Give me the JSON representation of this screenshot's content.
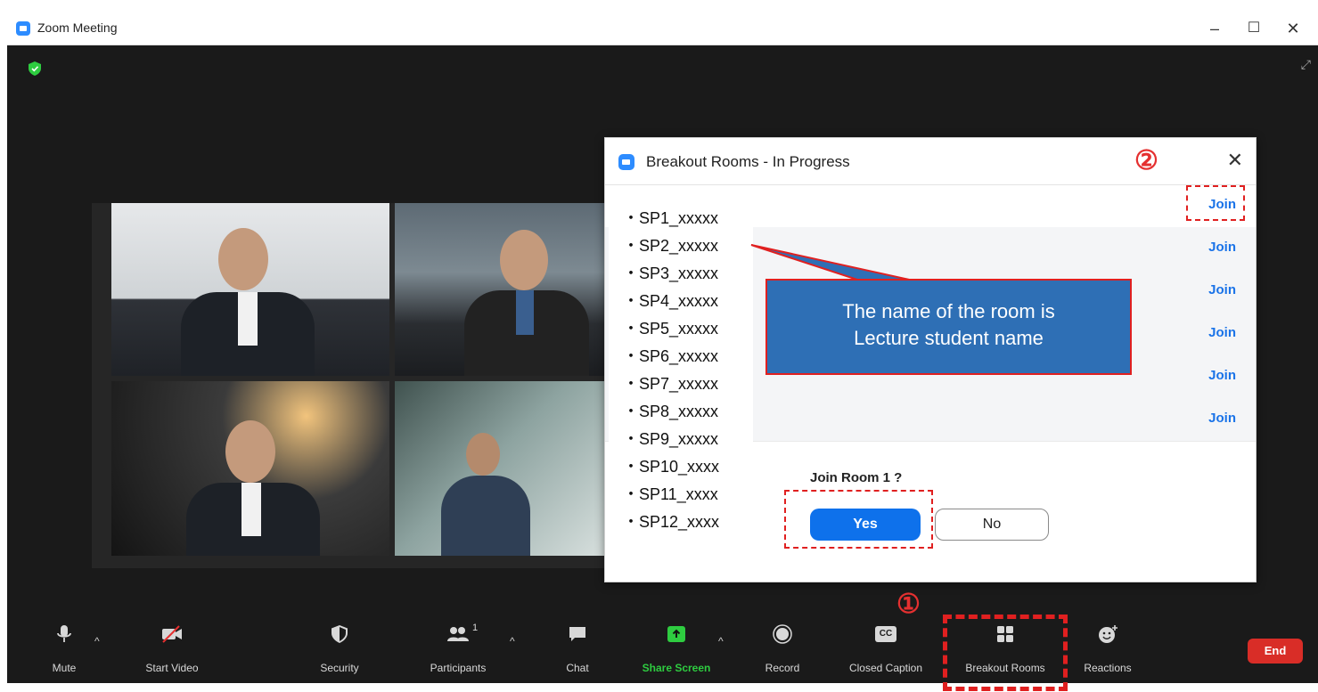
{
  "window": {
    "title": "Zoom Meeting",
    "controls": {
      "minimize": "–",
      "maximize": "☐",
      "close": "✕"
    }
  },
  "dialog": {
    "title": "Breakout Rooms - In Progress",
    "close": "✕",
    "rooms": [
      {
        "join": "Join"
      },
      {
        "join": "Join"
      },
      {
        "join": "Join"
      },
      {
        "join": "Join"
      },
      {
        "join": "Join"
      },
      {
        "join": "Join"
      }
    ],
    "prompt": "Join Room 1 ?",
    "yes": "Yes",
    "no": "No"
  },
  "room_list": [
    "・SP1_xxxxx",
    "・SP2_xxxxx",
    "・SP3_xxxxx",
    "・SP4_xxxxx",
    "・SP5_xxxxx",
    "・SP6_xxxxx",
    "・SP7_xxxxx",
    "・SP8_xxxxx",
    "・SP9_xxxxx",
    "・SP10_xxxx",
    "・SP11_xxxx",
    "・SP12_xxxx"
  ],
  "callout": {
    "line1": "The name of the room is",
    "line2": "Lecture student name"
  },
  "markers": {
    "step1": "①",
    "step2": "②"
  },
  "toolbar": {
    "mute": "Mute",
    "start_video": "Start Video",
    "security": "Security",
    "participants": "Participants",
    "participants_count": "1",
    "chat": "Chat",
    "share_screen": "Share Screen",
    "record": "Record",
    "closed_caption": "Closed Caption",
    "closed_caption_badge": "CC",
    "breakout_rooms": "Breakout Rooms",
    "reactions": "Reactions",
    "end": "End"
  },
  "colors": {
    "accent": "#0e71eb",
    "link": "#1a73e8",
    "annotation": "#e02020",
    "share_green": "#2ecc40",
    "end_red": "#d92d27",
    "callout_fill": "#2e6fb5"
  }
}
